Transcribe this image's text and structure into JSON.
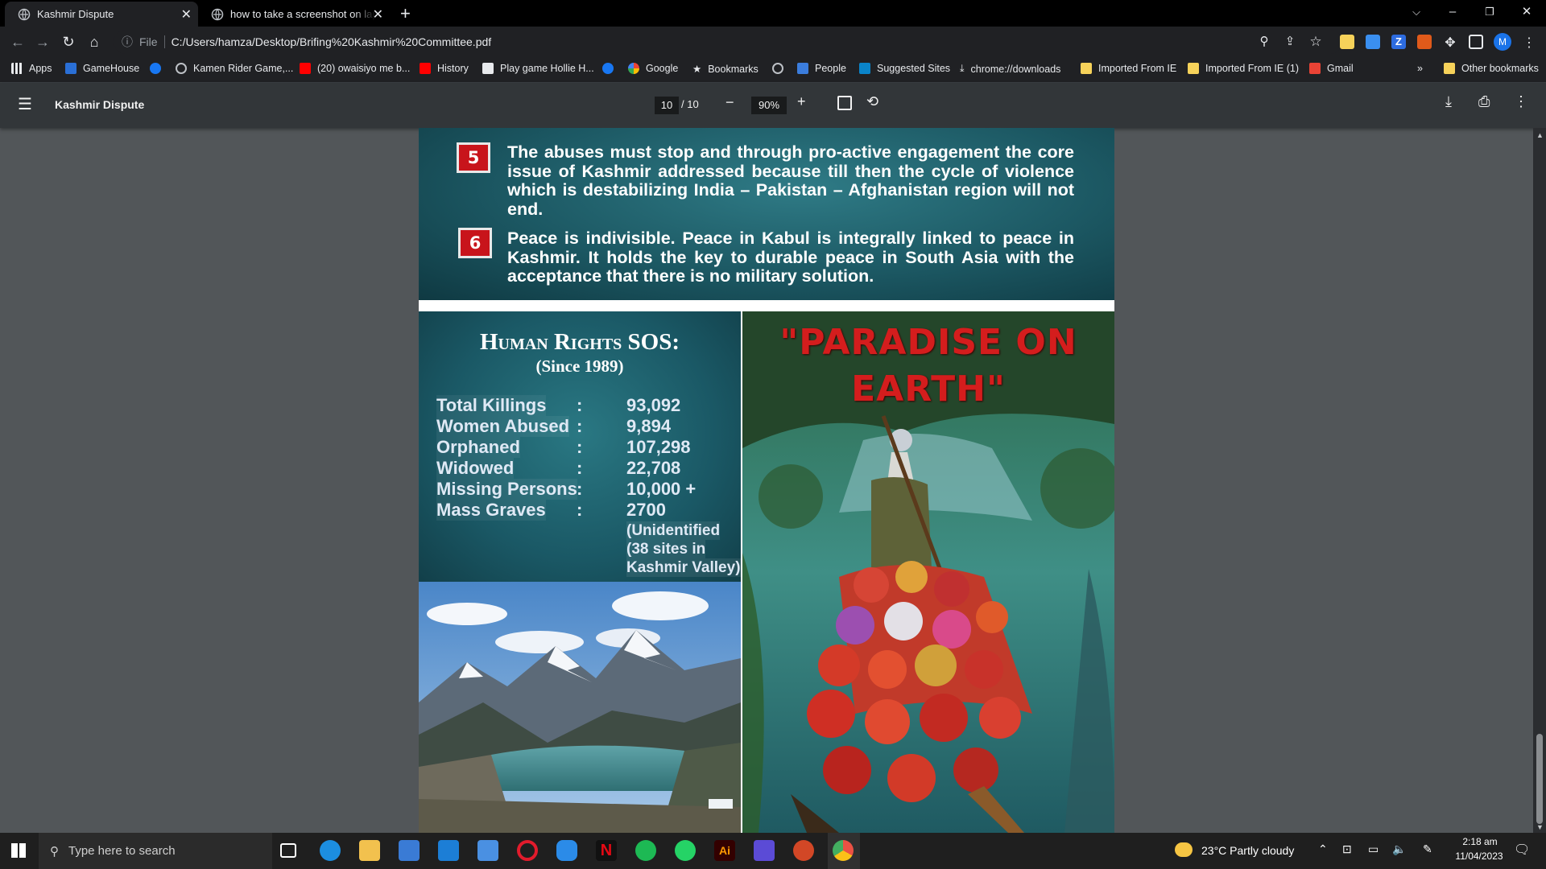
{
  "browser": {
    "tabs": [
      {
        "title": "Kashmir Dispute",
        "active": true
      },
      {
        "title": "how to take a screenshot on laptop",
        "active": false
      }
    ],
    "new_tab": "+",
    "address": {
      "scheme_label": "File",
      "url": "C:/Users/hamza/Desktop/Brifing%20Kashmir%20Committee.pdf"
    },
    "profile_initial": "M",
    "bookmarks": [
      {
        "label": "Apps",
        "icon": "apps-grid-icon"
      },
      {
        "label": "GameHouse",
        "icon": "gamehouse-icon"
      },
      {
        "label": "",
        "icon": "facebook-icon"
      },
      {
        "label": "Kamen Rider Game,...",
        "icon": "globe-icon"
      },
      {
        "label": "(20) owaisiyo me b...",
        "icon": "youtube-icon"
      },
      {
        "label": "History",
        "icon": "youtube-icon"
      },
      {
        "label": "Play game Hollie H...",
        "icon": "game-icon"
      },
      {
        "label": "",
        "icon": "facebook-icon"
      },
      {
        "label": "Google",
        "icon": "google-icon"
      },
      {
        "label": "Bookmarks",
        "icon": "star-icon"
      },
      {
        "label": "",
        "icon": "globe-icon"
      },
      {
        "label": "People",
        "icon": "people-icon"
      },
      {
        "label": "Suggested Sites",
        "icon": "bing-icon"
      },
      {
        "label": "chrome://downloads",
        "icon": "download-icon"
      },
      {
        "label": "Imported From IE",
        "icon": "folder-icon"
      },
      {
        "label": "Imported From IE (1)",
        "icon": "folder-icon"
      },
      {
        "label": "Gmail",
        "icon": "gmail-icon"
      }
    ],
    "overflow": "»",
    "other_bookmarks": "Other bookmarks"
  },
  "pdf": {
    "title": "Kashmir Dispute",
    "page_current": "10",
    "page_total": "/ 10",
    "zoom": "90%",
    "points": [
      {
        "num": "5",
        "text": "The abuses must stop and through pro-active engagement the core issue of Kashmir addressed because till then the cycle of violence which is destabilizing India – Pakistan – Afghanistan region will not end."
      },
      {
        "num": "6",
        "text": "Peace is indivisible. Peace in Kabul is integrally linked to peace in Kashmir. It holds the key to durable peace in South Asia with the acceptance that there is no military solution."
      }
    ],
    "sos": {
      "title": "Human Rights SOS:",
      "subtitle": "(Since 1989)",
      "rows": [
        {
          "label": "Total Killings",
          "colon": ":",
          "value": "93,092"
        },
        {
          "label": "Women Abused",
          "colon": ":",
          "value": "9,894"
        },
        {
          "label": "Orphaned",
          "colon": ":",
          "value": "107,298"
        },
        {
          "label": "Widowed",
          "colon": ":",
          "value": "22,708"
        },
        {
          "label": "Missing Persons",
          "colon": ":",
          "value": "10,000 +"
        },
        {
          "label": "Mass Graves",
          "colon": ":",
          "value": "2700"
        }
      ],
      "notes": [
        "(Unidentified",
        "(38 sites in",
        "Kashmir Valley)"
      ]
    },
    "paradise_line1": "\"PARADISE ON",
    "paradise_line2": "EARTH\""
  },
  "taskbar": {
    "search_placeholder": "Type here to search",
    "weather": "23°C  Partly cloudy",
    "time": "2:18 am",
    "date": "11/04/2023"
  }
}
